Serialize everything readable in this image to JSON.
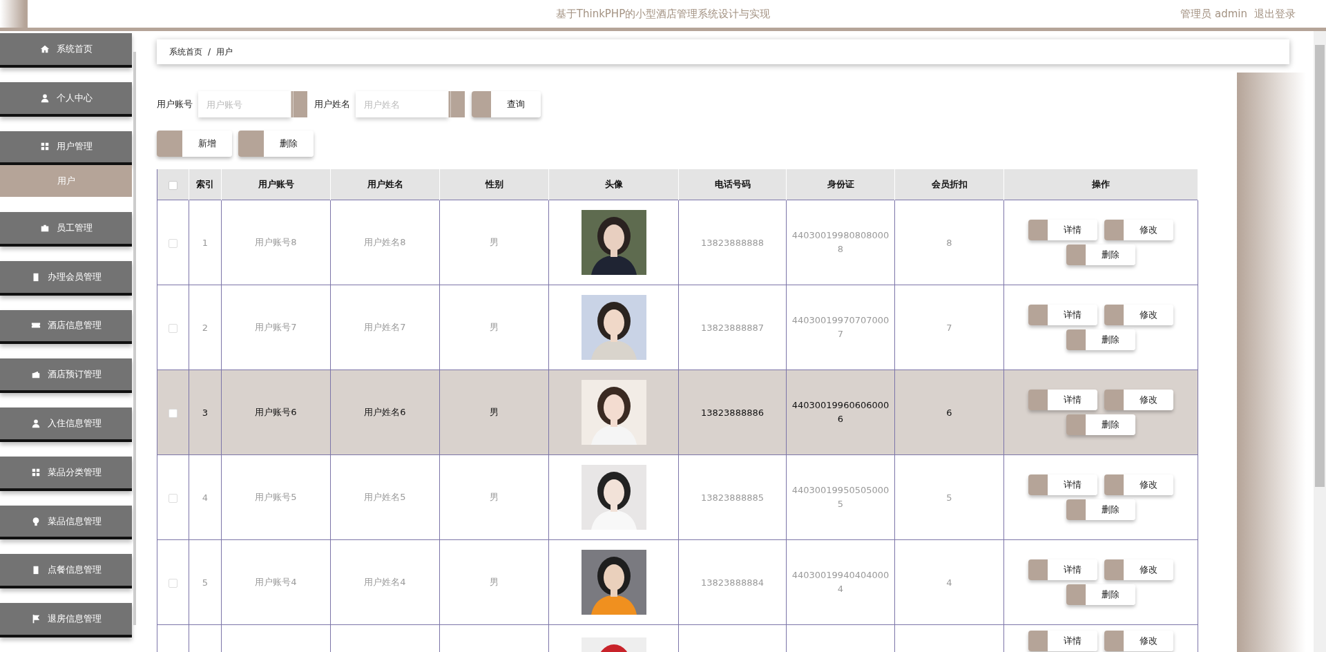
{
  "header": {
    "title": "基于ThinkPHP的小型酒店管理系统设计与实现",
    "user": "管理员 admin",
    "logout": "退出登录"
  },
  "sidebar": {
    "items": [
      {
        "label": "系统首页"
      },
      {
        "label": "个人中心"
      },
      {
        "label": "用户管理",
        "children": [
          {
            "label": "用户",
            "selected": true
          }
        ]
      },
      {
        "label": "员工管理"
      },
      {
        "label": "办理会员管理"
      },
      {
        "label": "酒店信息管理"
      },
      {
        "label": "酒店预订管理"
      },
      {
        "label": "入住信息管理"
      },
      {
        "label": "菜品分类管理"
      },
      {
        "label": "菜品信息管理"
      },
      {
        "label": "点餐信息管理"
      },
      {
        "label": "退房信息管理"
      }
    ]
  },
  "breadcrumb": {
    "items": [
      "系统首页",
      "用户"
    ],
    "separator": "/"
  },
  "search": {
    "fields": [
      {
        "label": "用户账号",
        "placeholder": "用户账号"
      },
      {
        "label": "用户姓名",
        "placeholder": "用户姓名"
      }
    ],
    "button": "查询"
  },
  "actions": [
    "新增",
    "删除"
  ],
  "table": {
    "select_all_checked": false,
    "columns": [
      "索引",
      "用户账号",
      "用户姓名",
      "性别",
      "头像",
      "电话号码",
      "身份证",
      "会员折扣",
      "操作"
    ],
    "rows": [
      {
        "index": "1",
        "account": "用户账号8",
        "name": "用户姓名8",
        "gender": "男",
        "phone": "13823888888",
        "id_card": "440300199808080008",
        "discount": "8",
        "checked": false,
        "selected": false,
        "actions": [
          "详情",
          "修改",
          "删除"
        ]
      },
      {
        "index": "2",
        "account": "用户账号7",
        "name": "用户姓名7",
        "gender": "男",
        "phone": "13823888887",
        "id_card": "440300199707070007",
        "discount": "7",
        "checked": false,
        "selected": false,
        "actions": [
          "详情",
          "修改",
          "删除"
        ]
      },
      {
        "index": "3",
        "account": "用户账号6",
        "name": "用户姓名6",
        "gender": "男",
        "phone": "13823888886",
        "id_card": "440300199606060006",
        "discount": "6",
        "checked": false,
        "selected": true,
        "actions": [
          "详情",
          "修改",
          "删除"
        ]
      },
      {
        "index": "4",
        "account": "用户账号5",
        "name": "用户姓名5",
        "gender": "男",
        "phone": "13823888885",
        "id_card": "440300199505050005",
        "discount": "5",
        "checked": false,
        "selected": false,
        "actions": [
          "详情",
          "修改",
          "删除"
        ]
      },
      {
        "index": "5",
        "account": "用户账号4",
        "name": "用户姓名4",
        "gender": "男",
        "phone": "13823888884",
        "id_card": "440300199404040004",
        "discount": "4",
        "checked": false,
        "selected": false,
        "actions": [
          "详情",
          "修改",
          "删除"
        ]
      },
      {
        "selected": false,
        "actions": [
          "详情",
          "修改"
        ]
      }
    ]
  }
}
